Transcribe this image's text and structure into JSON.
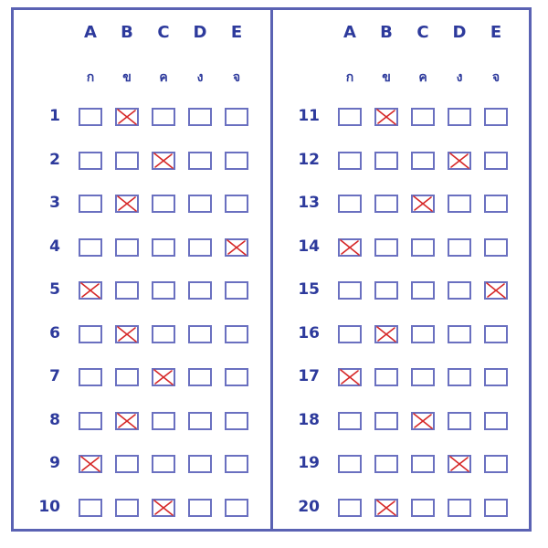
{
  "headers": {
    "letters": [
      "A",
      "B",
      "C",
      "D",
      "E"
    ],
    "thai": [
      "ก",
      "ข",
      "ค",
      "ง",
      "จ"
    ]
  },
  "columns": [
    {
      "questions": [
        {
          "number": "1",
          "marked": "B"
        },
        {
          "number": "2",
          "marked": "C"
        },
        {
          "number": "3",
          "marked": "B"
        },
        {
          "number": "4",
          "marked": "E"
        },
        {
          "number": "5",
          "marked": "A"
        },
        {
          "number": "6",
          "marked": "B"
        },
        {
          "number": "7",
          "marked": "C"
        },
        {
          "number": "8",
          "marked": "B"
        },
        {
          "number": "9",
          "marked": "A"
        },
        {
          "number": "10",
          "marked": "C"
        }
      ]
    },
    {
      "questions": [
        {
          "number": "11",
          "marked": "B"
        },
        {
          "number": "12",
          "marked": "D"
        },
        {
          "number": "13",
          "marked": "C"
        },
        {
          "number": "14",
          "marked": "A"
        },
        {
          "number": "15",
          "marked": "E"
        },
        {
          "number": "16",
          "marked": "B"
        },
        {
          "number": "17",
          "marked": "A"
        },
        {
          "number": "18",
          "marked": "C"
        },
        {
          "number": "19",
          "marked": "D"
        },
        {
          "number": "20",
          "marked": "B"
        }
      ]
    }
  ],
  "colors": {
    "border": "#5a62b3",
    "text": "#2d3a9c",
    "box": "#6a70c0",
    "mark": "#d62828"
  }
}
